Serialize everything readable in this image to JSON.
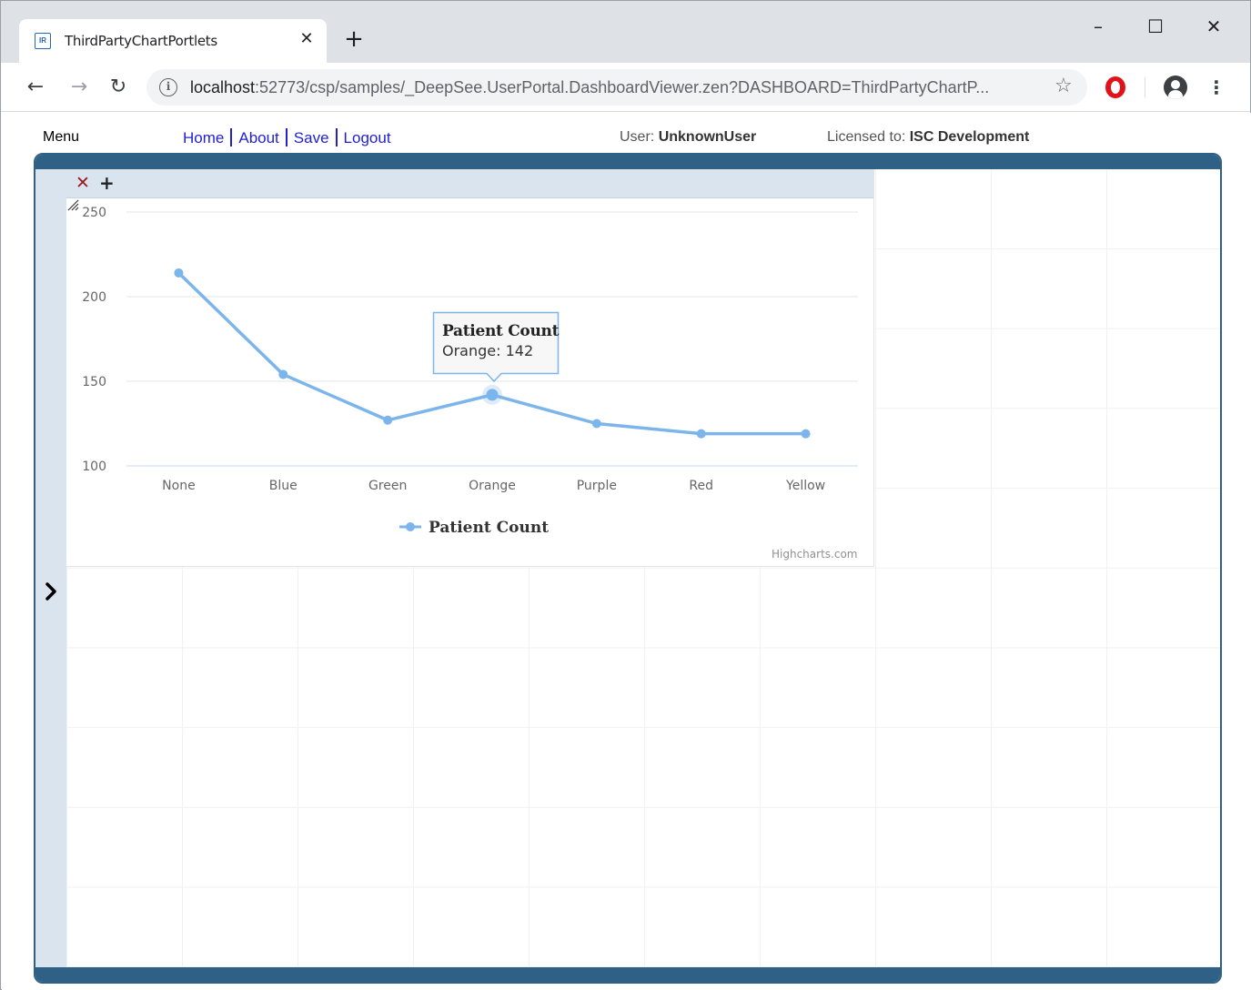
{
  "browser": {
    "tab_title": "ThirdPartyChartPortlets",
    "favicon_text": "IR",
    "url_host": "localhost",
    "url_rest": ":52773/csp/samples/_DeepSee.UserPortal.DashboardViewer.zen?DASHBOARD=ThirdPartyChartP...",
    "icons": [
      "back-icon",
      "forward-icon",
      "reload-icon",
      "info-icon",
      "star-icon",
      "opera-icon",
      "profile-icon",
      "kebab-icon"
    ]
  },
  "header": {
    "menu_label": "Menu",
    "nav": {
      "home": "Home",
      "about": "About",
      "save": "Save",
      "logout": "Logout"
    },
    "user_label": "User:",
    "user_name": "UnknownUser",
    "license_label": "Licensed to:",
    "license_name": "ISC Development"
  },
  "widget": {
    "close_glyph": "✕",
    "add_glyph": "+",
    "credits": "Highcharts.com"
  },
  "tooltip": {
    "title": "Patient Count",
    "text": "Orange: 142"
  },
  "colors": {
    "series": "#7cb5ec",
    "frame": "#2f6186",
    "panel": "#d9e4ef",
    "link": "#1f1fd6"
  },
  "chart_data": {
    "type": "line",
    "categories": [
      "None",
      "Blue",
      "Green",
      "Orange",
      "Purple",
      "Red",
      "Yellow"
    ],
    "series": [
      {
        "name": "Patient Count",
        "values": [
          214,
          154,
          127,
          142,
          125,
          119,
          119
        ]
      }
    ],
    "title": "",
    "xlabel": "",
    "ylabel": "",
    "ylim": [
      100,
      250
    ],
    "yticks": [
      100,
      150,
      200,
      250
    ],
    "grid": true,
    "legend": "bottom-center",
    "highlighted_category": "Orange"
  }
}
